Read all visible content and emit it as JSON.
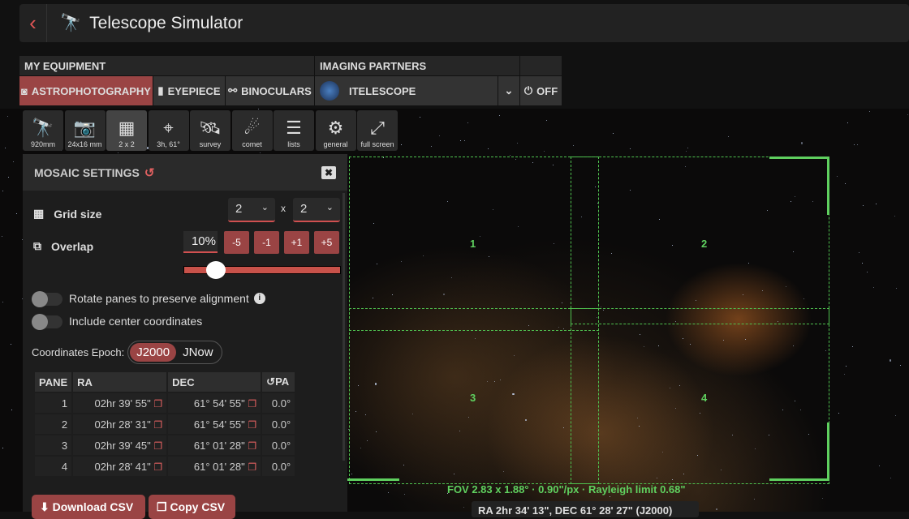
{
  "app": {
    "title": "Telescope Simulator"
  },
  "equipment": {
    "header": "MY EQUIPMENT",
    "tabs": [
      {
        "label": "ASTROPHOTOGRAPHY",
        "active": true
      },
      {
        "label": "EYEPIECE"
      },
      {
        "label": "BINOCULARS"
      }
    ]
  },
  "partners": {
    "header": "IMAGING PARTNERS",
    "selected": "ITELESCOPE",
    "power": "OFF"
  },
  "toolbar": [
    {
      "icon": "telescope-icon",
      "label": "920mm"
    },
    {
      "icon": "camera-icon",
      "label": "24x16 mm"
    },
    {
      "icon": "grid-icon",
      "label": "2 x 2",
      "active": true
    },
    {
      "icon": "crosshair-icon",
      "label": "3h, 61°"
    },
    {
      "icon": "satellite-icon",
      "label": "survey"
    },
    {
      "icon": "comet-icon",
      "label": "comet"
    },
    {
      "icon": "list-icon",
      "label": "lists"
    },
    {
      "icon": "gear-icon",
      "label": "general"
    },
    {
      "icon": "fullscreen-icon",
      "label": "full screen"
    }
  ],
  "mosaic": {
    "title": "MOSAIC SETTINGS",
    "grid_label": "Grid size",
    "grid_cols": "2",
    "grid_rows": "2",
    "x": "x",
    "overlap_label": "Overlap",
    "overlap_value": "10%",
    "overlap_fraction": 0.2,
    "steps": [
      "-5",
      "-1",
      "+1",
      "+5"
    ],
    "rotate_label": "Rotate panes to preserve alignment",
    "rotate_on": false,
    "center_label": "Include center coordinates",
    "center_on": false,
    "epoch_label": "Coordinates Epoch:",
    "epochs": [
      "J2000",
      "JNow"
    ],
    "epoch_selected": "J2000",
    "columns": [
      "PANE",
      "RA",
      "DEC",
      "PA"
    ],
    "rows": [
      {
        "pane": "1",
        "ra": "02hr 39' 55\"",
        "dec": "61° 54' 55\"",
        "pa": "0.0°"
      },
      {
        "pane": "2",
        "ra": "02hr 28' 31\"",
        "dec": "61° 54' 55\"",
        "pa": "0.0°"
      },
      {
        "pane": "3",
        "ra": "02hr 39' 45\"",
        "dec": "61° 01' 28\"",
        "pa": "0.0°"
      },
      {
        "pane": "4",
        "ra": "02hr 28' 41\"",
        "dec": "61° 01' 28\"",
        "pa": "0.0°"
      }
    ],
    "download": "Download CSV",
    "copy": "Copy CSV"
  },
  "view": {
    "pane_labels": [
      "1",
      "2",
      "3",
      "4"
    ],
    "fov": "FOV 2.83 x 1.88° · 0.90\"/px · Rayleigh limit 0.68\"",
    "coords": "RA 2hr 34' 13\", DEC 61° 28' 27\" (J2000)"
  },
  "colors": {
    "accent": "#9a4444",
    "frame": "#5fd05f"
  }
}
